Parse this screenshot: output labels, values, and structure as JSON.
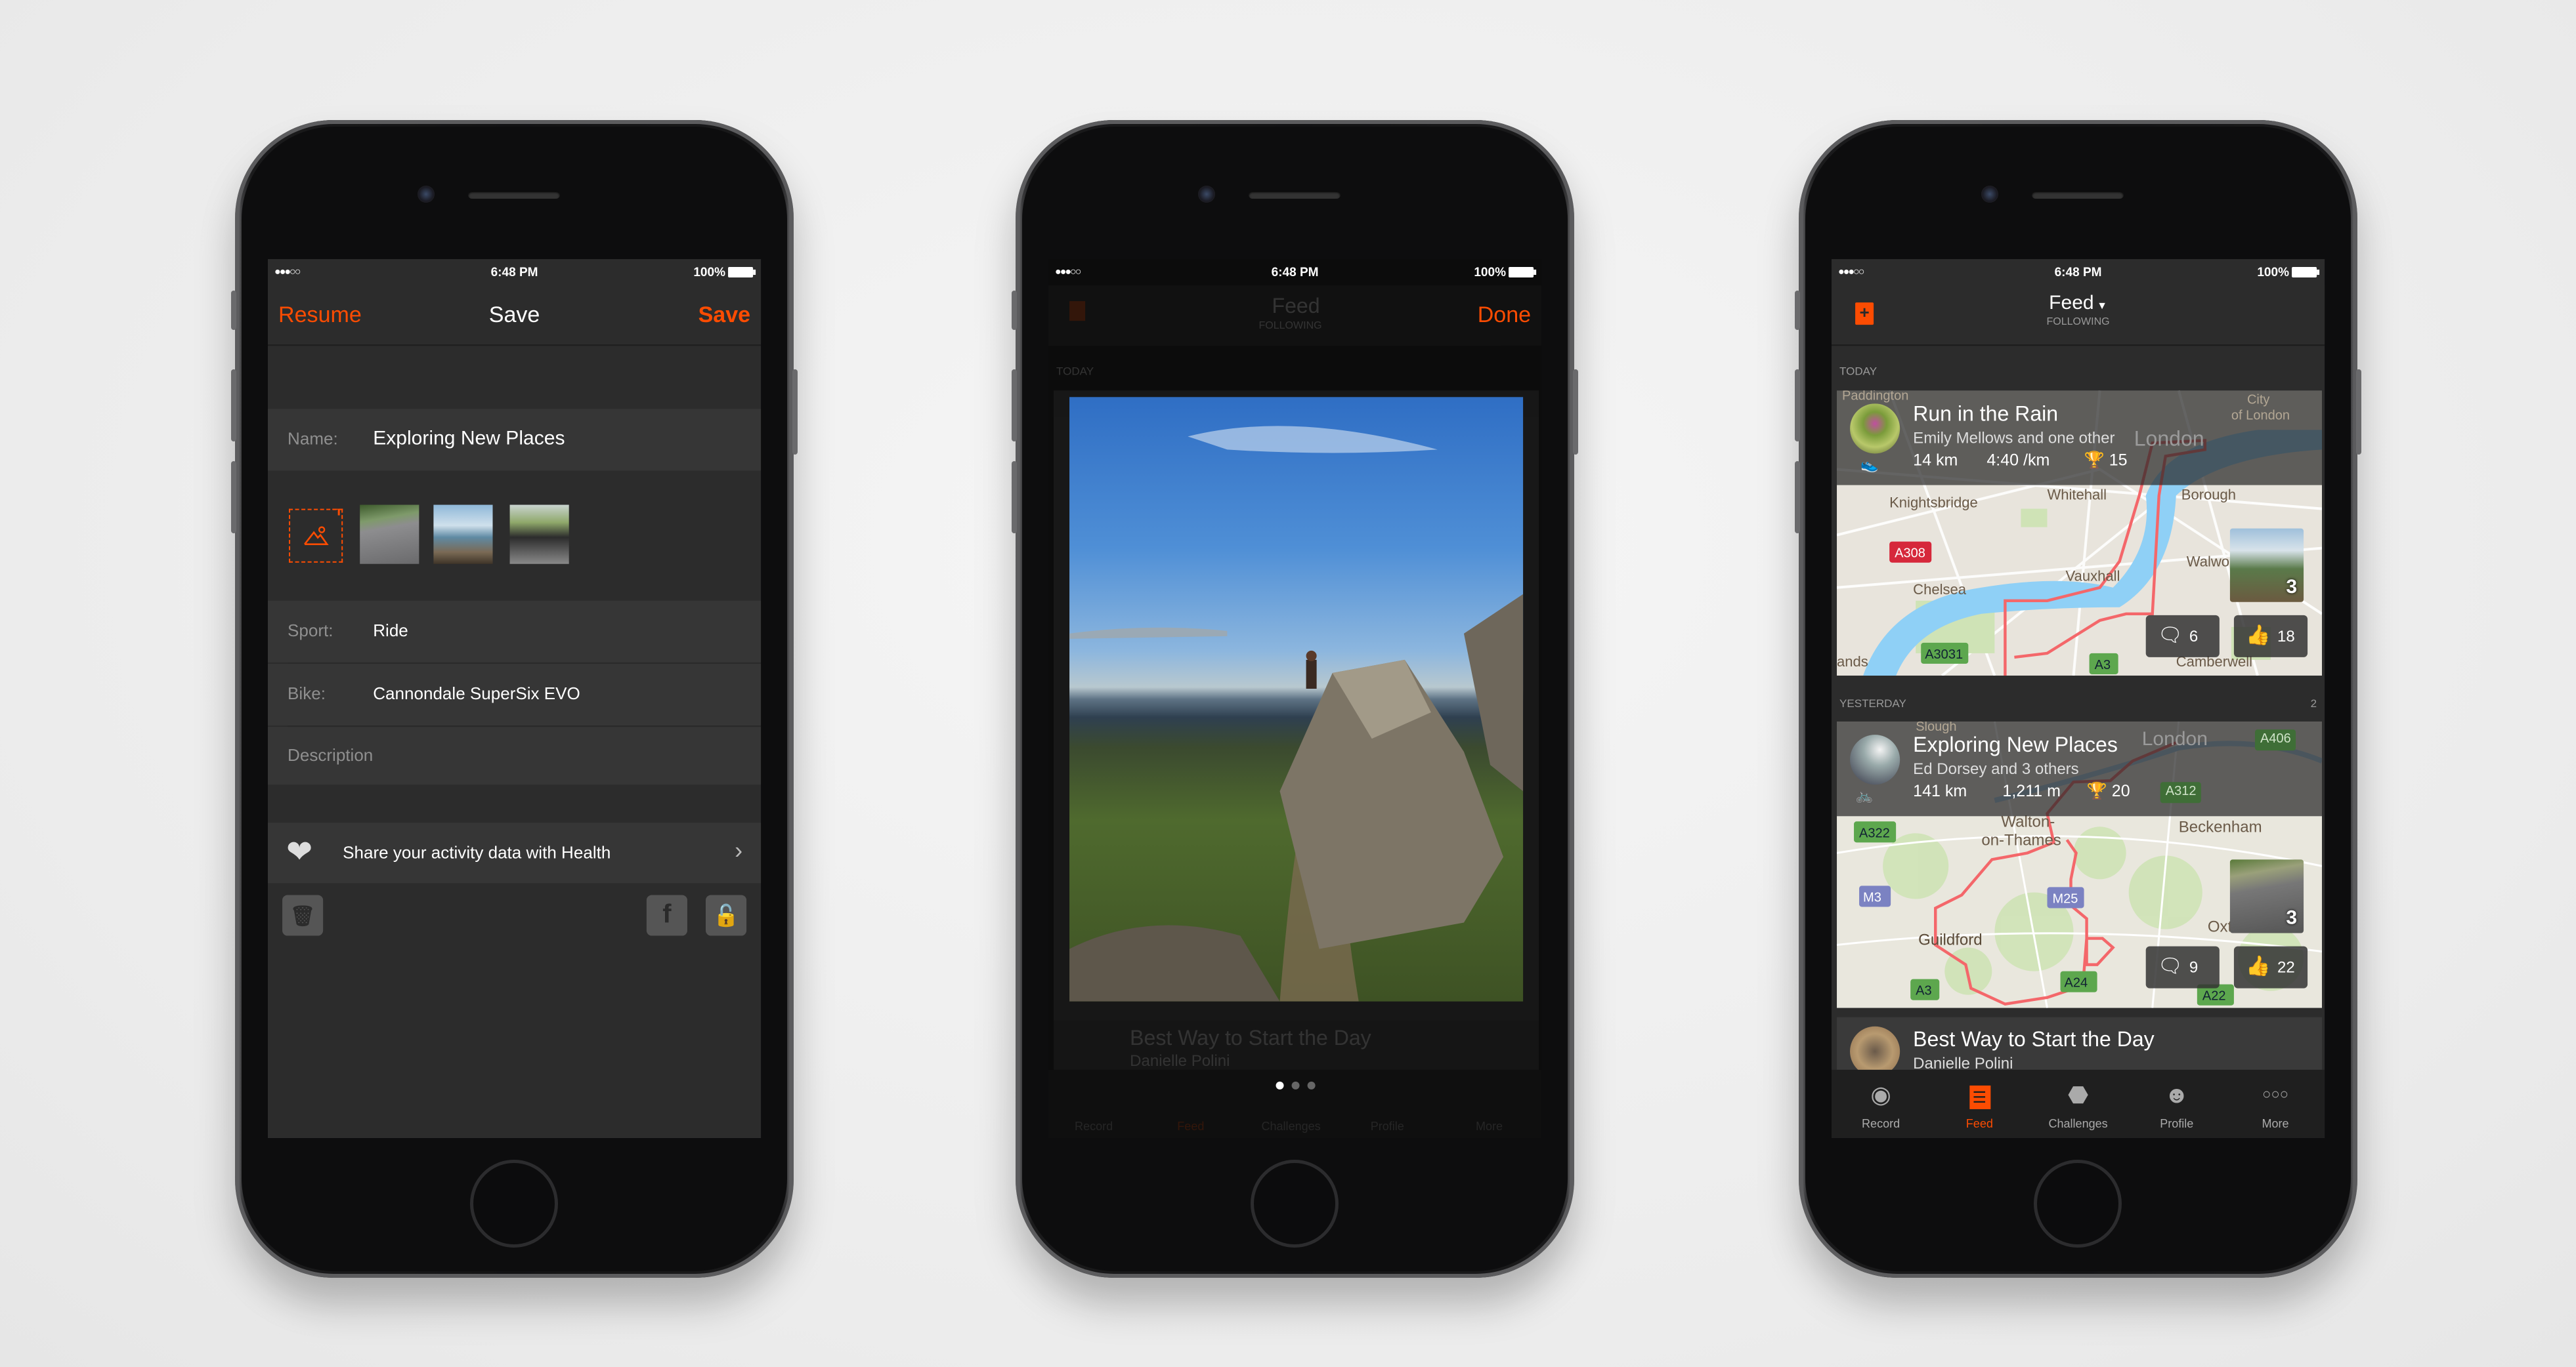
{
  "accent_color": "#fc4c02",
  "status_bar": {
    "signal": "●●●○○",
    "time": "6:48 PM",
    "battery": "100%"
  },
  "save_screen": {
    "nav": {
      "left_button": "Resume",
      "title": "Save",
      "right_button": "Save"
    },
    "name_label": "Name:",
    "name_value": "Exploring New Places",
    "add_photo_icon": "image-plus-icon",
    "sport_label": "Sport:",
    "sport_value": "Ride",
    "bike_label": "Bike:",
    "bike_value": "Cannondale SuperSix EVO",
    "description_placeholder": "Description",
    "health_row": {
      "icon": "heart-icon",
      "label": "Share your activity data with Health"
    },
    "buttons": {
      "delete": "trash-icon",
      "facebook": "f",
      "privacy": "lock-icon"
    }
  },
  "photo_screen": {
    "nav": {
      "title": "Feed",
      "subtitle": "FOLLOWING",
      "done": "Done"
    },
    "section": "TODAY",
    "background_card_title": "Best Way to Start the Day",
    "background_card_athlete": "Danielle Polini",
    "tabs": [
      "Record",
      "Feed",
      "Challenges",
      "Profile",
      "More"
    ],
    "page_indicator": {
      "pages": 3,
      "current": 1
    }
  },
  "feed_screen": {
    "nav": {
      "title": "Feed",
      "subtitle": "FOLLOWING",
      "add_icon": "add-manual-icon"
    },
    "today_label": "TODAY",
    "yesterday_label": "YESTERDAY",
    "yesterday_count": "2",
    "activities": [
      {
        "title": "Run in the Rain",
        "athletes": "Emily Mellows and one other",
        "sport": "run",
        "distance": "14 km",
        "second_stat": "4:40 /km",
        "achievements": "15",
        "photo_count": "3",
        "comments": "6",
        "kudos": "18",
        "map_labels": {
          "paddington": "Paddington",
          "city": "City",
          "of_london": "of London",
          "london": "London",
          "whitehall": "Whitehall",
          "borough": "Borough",
          "knightsbridge": "Knightsbridge",
          "a308": "A308",
          "walworth": "Walwo",
          "vauxhall": "Vauxhall",
          "chelsea": "Chelsea",
          "a3031": "A3031",
          "a3": "A3",
          "camberwell": "Camberwell",
          "ands": "ands"
        }
      },
      {
        "title": "Exploring New Places",
        "athletes": "Ed Dorsey and 3 others",
        "sport": "ride",
        "distance": "141 km",
        "second_stat": "1,211 m",
        "achievements": "20",
        "photo_count": "3",
        "comments": "9",
        "kudos": "22",
        "map_labels": {
          "slough": "Slough",
          "london": "London",
          "a406": "A406",
          "a312": "A312",
          "walton": "Walton-",
          "on_thames": "on-Thames",
          "beckenham": "Beckenham",
          "a322": "A322",
          "m3": "M3",
          "m25": "M25",
          "guildford": "Guildford",
          "oxted": "Oxted",
          "a3": "A3",
          "a24": "A24",
          "a22": "A22"
        }
      },
      {
        "title": "Best Way to Start the Day",
        "athletes": "Danielle Polini"
      }
    ],
    "tabs": [
      {
        "label": "Record",
        "icon": "record-icon"
      },
      {
        "label": "Feed",
        "icon": "feed-icon",
        "active": true
      },
      {
        "label": "Challenges",
        "icon": "challenges-icon"
      },
      {
        "label": "Profile",
        "icon": "profile-icon"
      },
      {
        "label": "More",
        "icon": "more-icon"
      }
    ]
  }
}
